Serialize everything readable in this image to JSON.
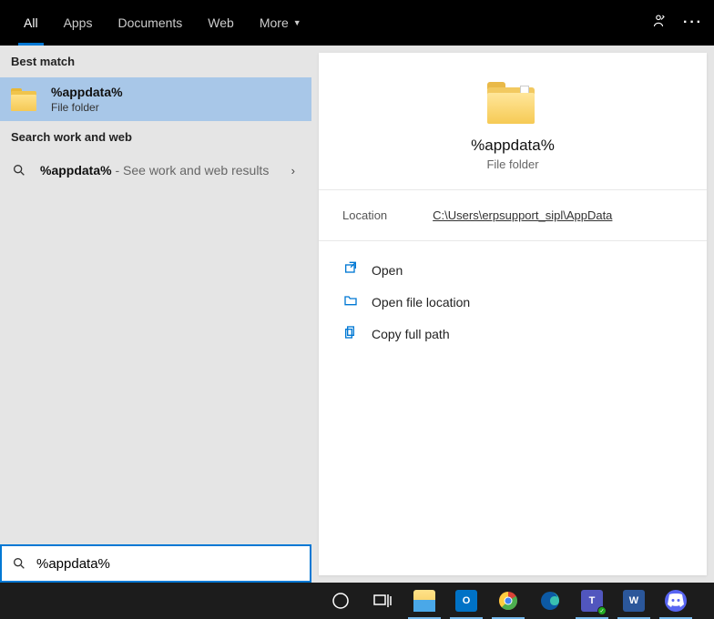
{
  "tabs": {
    "all": "All",
    "apps": "Apps",
    "documents": "Documents",
    "web": "Web",
    "more": "More"
  },
  "sections": {
    "best_match": "Best match",
    "search_work_web": "Search work and web"
  },
  "best_match_result": {
    "title": "%appdata%",
    "subtitle": "File folder"
  },
  "web_result": {
    "term": "%appdata%",
    "hint": " - See work and web results"
  },
  "preview": {
    "title": "%appdata%",
    "subtitle": "File folder",
    "location_label": "Location",
    "location_path": "C:\\Users\\erpsupport_sipl\\AppData"
  },
  "actions": {
    "open": "Open",
    "open_location": "Open file location",
    "copy_path": "Copy full path"
  },
  "search": {
    "value": "%appdata%"
  }
}
